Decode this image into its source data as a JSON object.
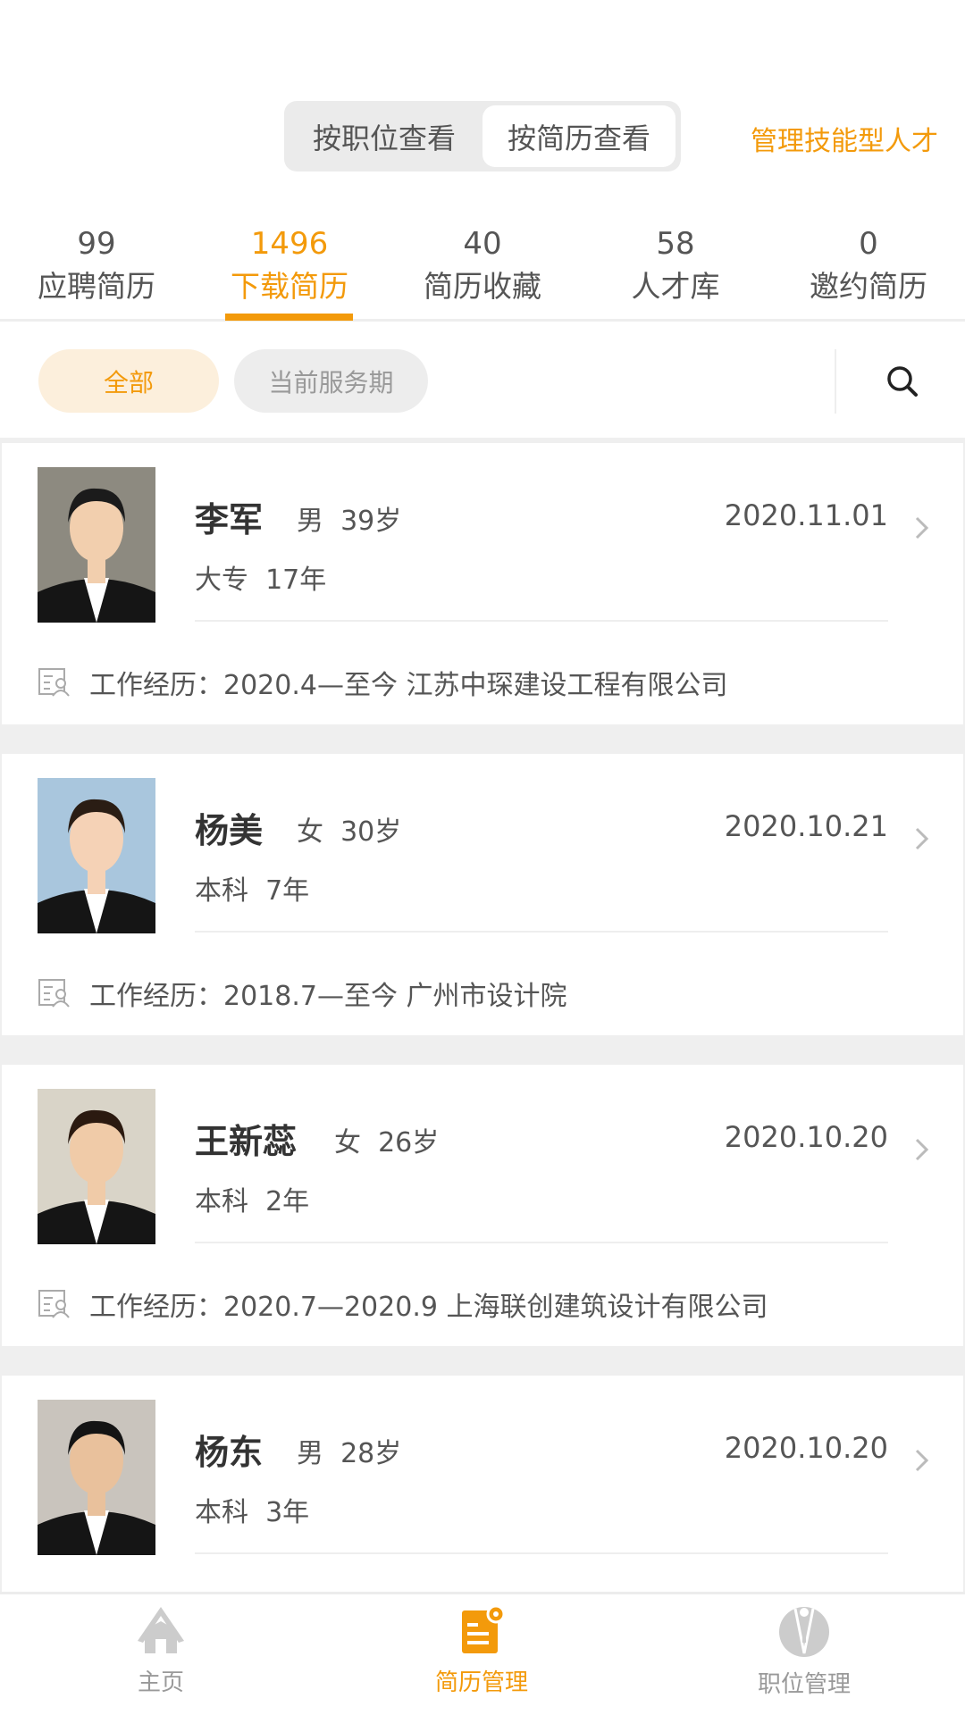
{
  "header": {
    "segments": [
      "按职位查看",
      "按简历查看"
    ],
    "active_segment": 1,
    "manage_link": "管理技能型人才"
  },
  "tabs": [
    {
      "count": "99",
      "label": "应聘简历"
    },
    {
      "count": "1496",
      "label": "下载简历"
    },
    {
      "count": "40",
      "label": "简历收藏"
    },
    {
      "count": "58",
      "label": "人才库"
    },
    {
      "count": "0",
      "label": "邀约简历"
    }
  ],
  "active_tab": 1,
  "filters": {
    "all": "全部",
    "current": "当前服务期",
    "search_icon": "search-icon"
  },
  "accent_color": "#f39a0b",
  "resumes": [
    {
      "name": "李军",
      "gender": "男",
      "age": "39岁",
      "date": "2020.11.01",
      "education": "大专",
      "experience": "17年",
      "work": "工作经历：2020.4—至今  江苏中琛建设工程有限公司"
    },
    {
      "name": "杨美",
      "gender": "女",
      "age": "30岁",
      "date": "2020.10.21",
      "education": "本科",
      "experience": "7年",
      "work": "工作经历：2018.7—至今  广州市设计院"
    },
    {
      "name": "王新蕊",
      "gender": "女",
      "age": "26岁",
      "date": "2020.10.20",
      "education": "本科",
      "experience": "2年",
      "work": "工作经历：2020.7—2020.9  上海联创建筑设计有限公司"
    },
    {
      "name": "杨东",
      "gender": "男",
      "age": "28岁",
      "date": "2020.10.20",
      "education": "本科",
      "experience": "3年",
      "work": ""
    }
  ],
  "bottom_nav": [
    {
      "label": "主页",
      "icon": "home-icon"
    },
    {
      "label": "简历管理",
      "icon": "resume-manage-icon"
    },
    {
      "label": "职位管理",
      "icon": "job-manage-icon"
    }
  ]
}
